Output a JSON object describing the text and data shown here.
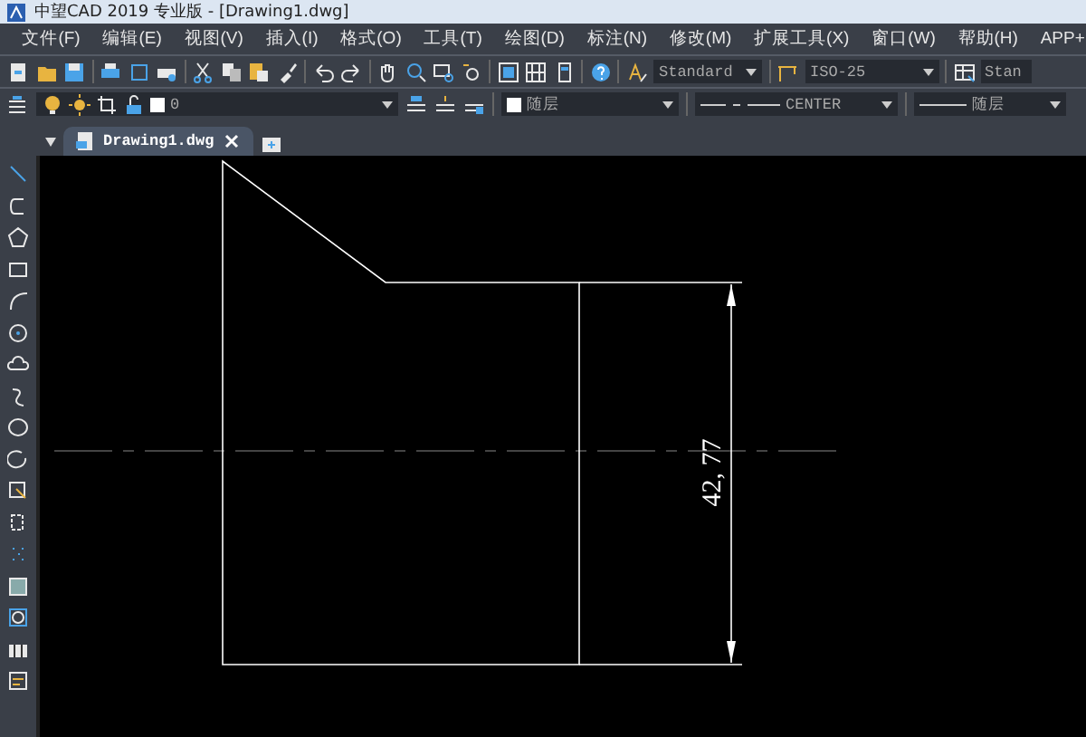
{
  "window": {
    "title": "中望CAD 2019 专业版 - [Drawing1.dwg]"
  },
  "menu": [
    "文件(F)",
    "编辑(E)",
    "视图(V)",
    "插入(I)",
    "格式(O)",
    "工具(T)",
    "绘图(D)",
    "标注(N)",
    "修改(M)",
    "扩展工具(X)",
    "窗口(W)",
    "帮助(H)",
    "APP+"
  ],
  "toolbar": {
    "text_style": "Standard",
    "dim_style": "ISO-25",
    "table_style": "Stan"
  },
  "layers": {
    "layer": "0",
    "color_control": "随层",
    "linetype": "CENTER",
    "lineweight": "随层"
  },
  "tabs": [
    {
      "label": "Drawing1.dwg",
      "selected": true
    }
  ],
  "drawing": {
    "dimension": "42, 77"
  }
}
